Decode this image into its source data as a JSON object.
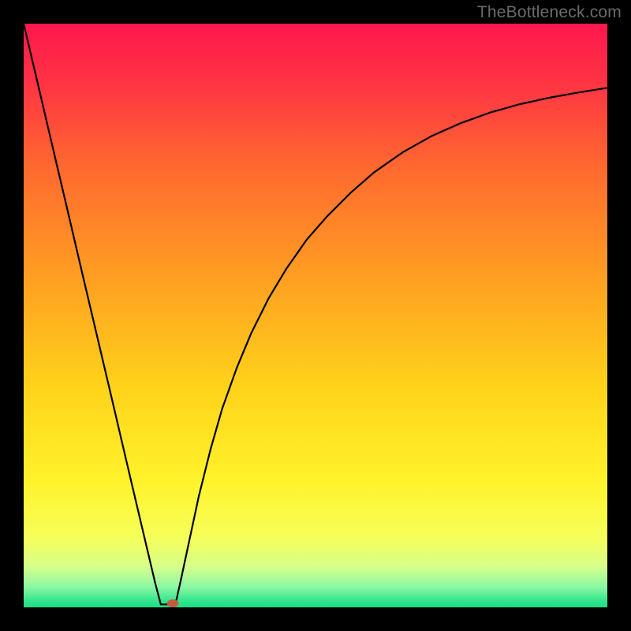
{
  "watermark": "TheBottleneck.com",
  "chart_data": {
    "type": "line",
    "title": "",
    "xlabel": "",
    "ylabel": "",
    "xlim": [
      0,
      100
    ],
    "ylim": [
      0,
      100
    ],
    "grid": false,
    "legend": false,
    "background_gradient": {
      "stops": [
        {
          "pos": 0.0,
          "color": "#ff174d"
        },
        {
          "pos": 0.1,
          "color": "#ff3344"
        },
        {
          "pos": 0.25,
          "color": "#ff6a2f"
        },
        {
          "pos": 0.45,
          "color": "#ffa321"
        },
        {
          "pos": 0.62,
          "color": "#ffd21a"
        },
        {
          "pos": 0.78,
          "color": "#fff22a"
        },
        {
          "pos": 0.88,
          "color": "#f6ff5a"
        },
        {
          "pos": 0.93,
          "color": "#d6ff8a"
        },
        {
          "pos": 0.965,
          "color": "#8cf7a3"
        },
        {
          "pos": 0.99,
          "color": "#2fe58c"
        },
        {
          "pos": 1.0,
          "color": "#1adf85"
        }
      ]
    },
    "series": [
      {
        "name": "left-branch",
        "x": [
          0.0,
          2.5,
          5.0,
          7.5,
          10.0,
          12.5,
          15.0,
          17.5,
          20.0,
          22.5,
          23.5
        ],
        "y": [
          100.0,
          89.4,
          78.7,
          68.1,
          57.4,
          46.8,
          36.2,
          25.5,
          14.9,
          4.3,
          0.5
        ]
      },
      {
        "name": "valley-floor",
        "x": [
          23.5,
          25.0,
          26.0
        ],
        "y": [
          0.5,
          0.5,
          0.5
        ]
      },
      {
        "name": "right-branch",
        "x": [
          26.0,
          27.0,
          28.5,
          30.0,
          32.0,
          34.0,
          36.5,
          39.0,
          42.0,
          45.0,
          48.5,
          52.0,
          56.0,
          60.0,
          65.0,
          70.0,
          75.0,
          80.0,
          85.0,
          90.0,
          95.0,
          100.0
        ],
        "y": [
          0.5,
          5.0,
          12.0,
          19.0,
          27.0,
          34.0,
          41.0,
          47.0,
          53.0,
          58.0,
          63.0,
          67.0,
          71.0,
          74.5,
          78.0,
          80.8,
          83.0,
          84.8,
          86.2,
          87.3,
          88.2,
          89.0
        ]
      }
    ],
    "marker": {
      "x": 25.5,
      "y": 0.7,
      "color": "#c65a3f"
    }
  }
}
